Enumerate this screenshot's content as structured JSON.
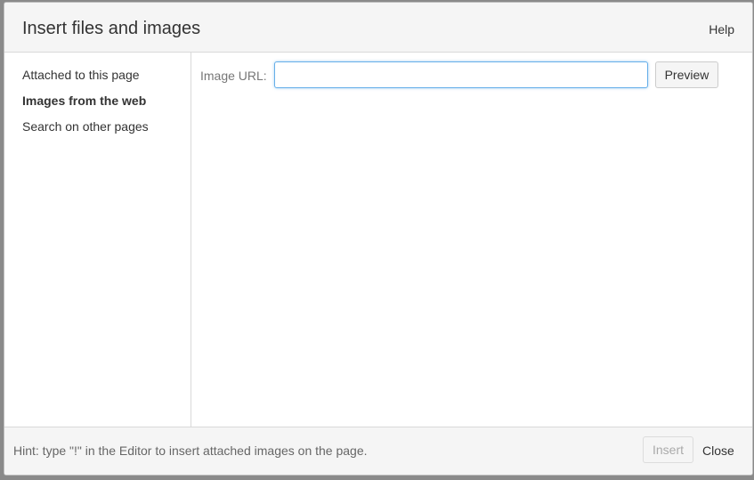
{
  "dialog": {
    "title": "Insert files and images",
    "help_label": "Help"
  },
  "sidebar": {
    "items": [
      {
        "label": "Attached to this page",
        "active": false
      },
      {
        "label": "Images from the web",
        "active": true
      },
      {
        "label": "Search on other pages",
        "active": false
      }
    ]
  },
  "main": {
    "url_label": "Image URL:",
    "url_value": "",
    "url_placeholder": "",
    "preview_label": "Preview"
  },
  "footer": {
    "hint": "Hint: type \"!\" in the Editor to insert attached images on the page.",
    "insert_label": "Insert",
    "insert_disabled": true,
    "close_label": "Close"
  },
  "colors": {
    "header_bg": "#f5f5f5",
    "focus_border": "#66afe9",
    "text": "#333333",
    "muted_text": "#777777"
  }
}
